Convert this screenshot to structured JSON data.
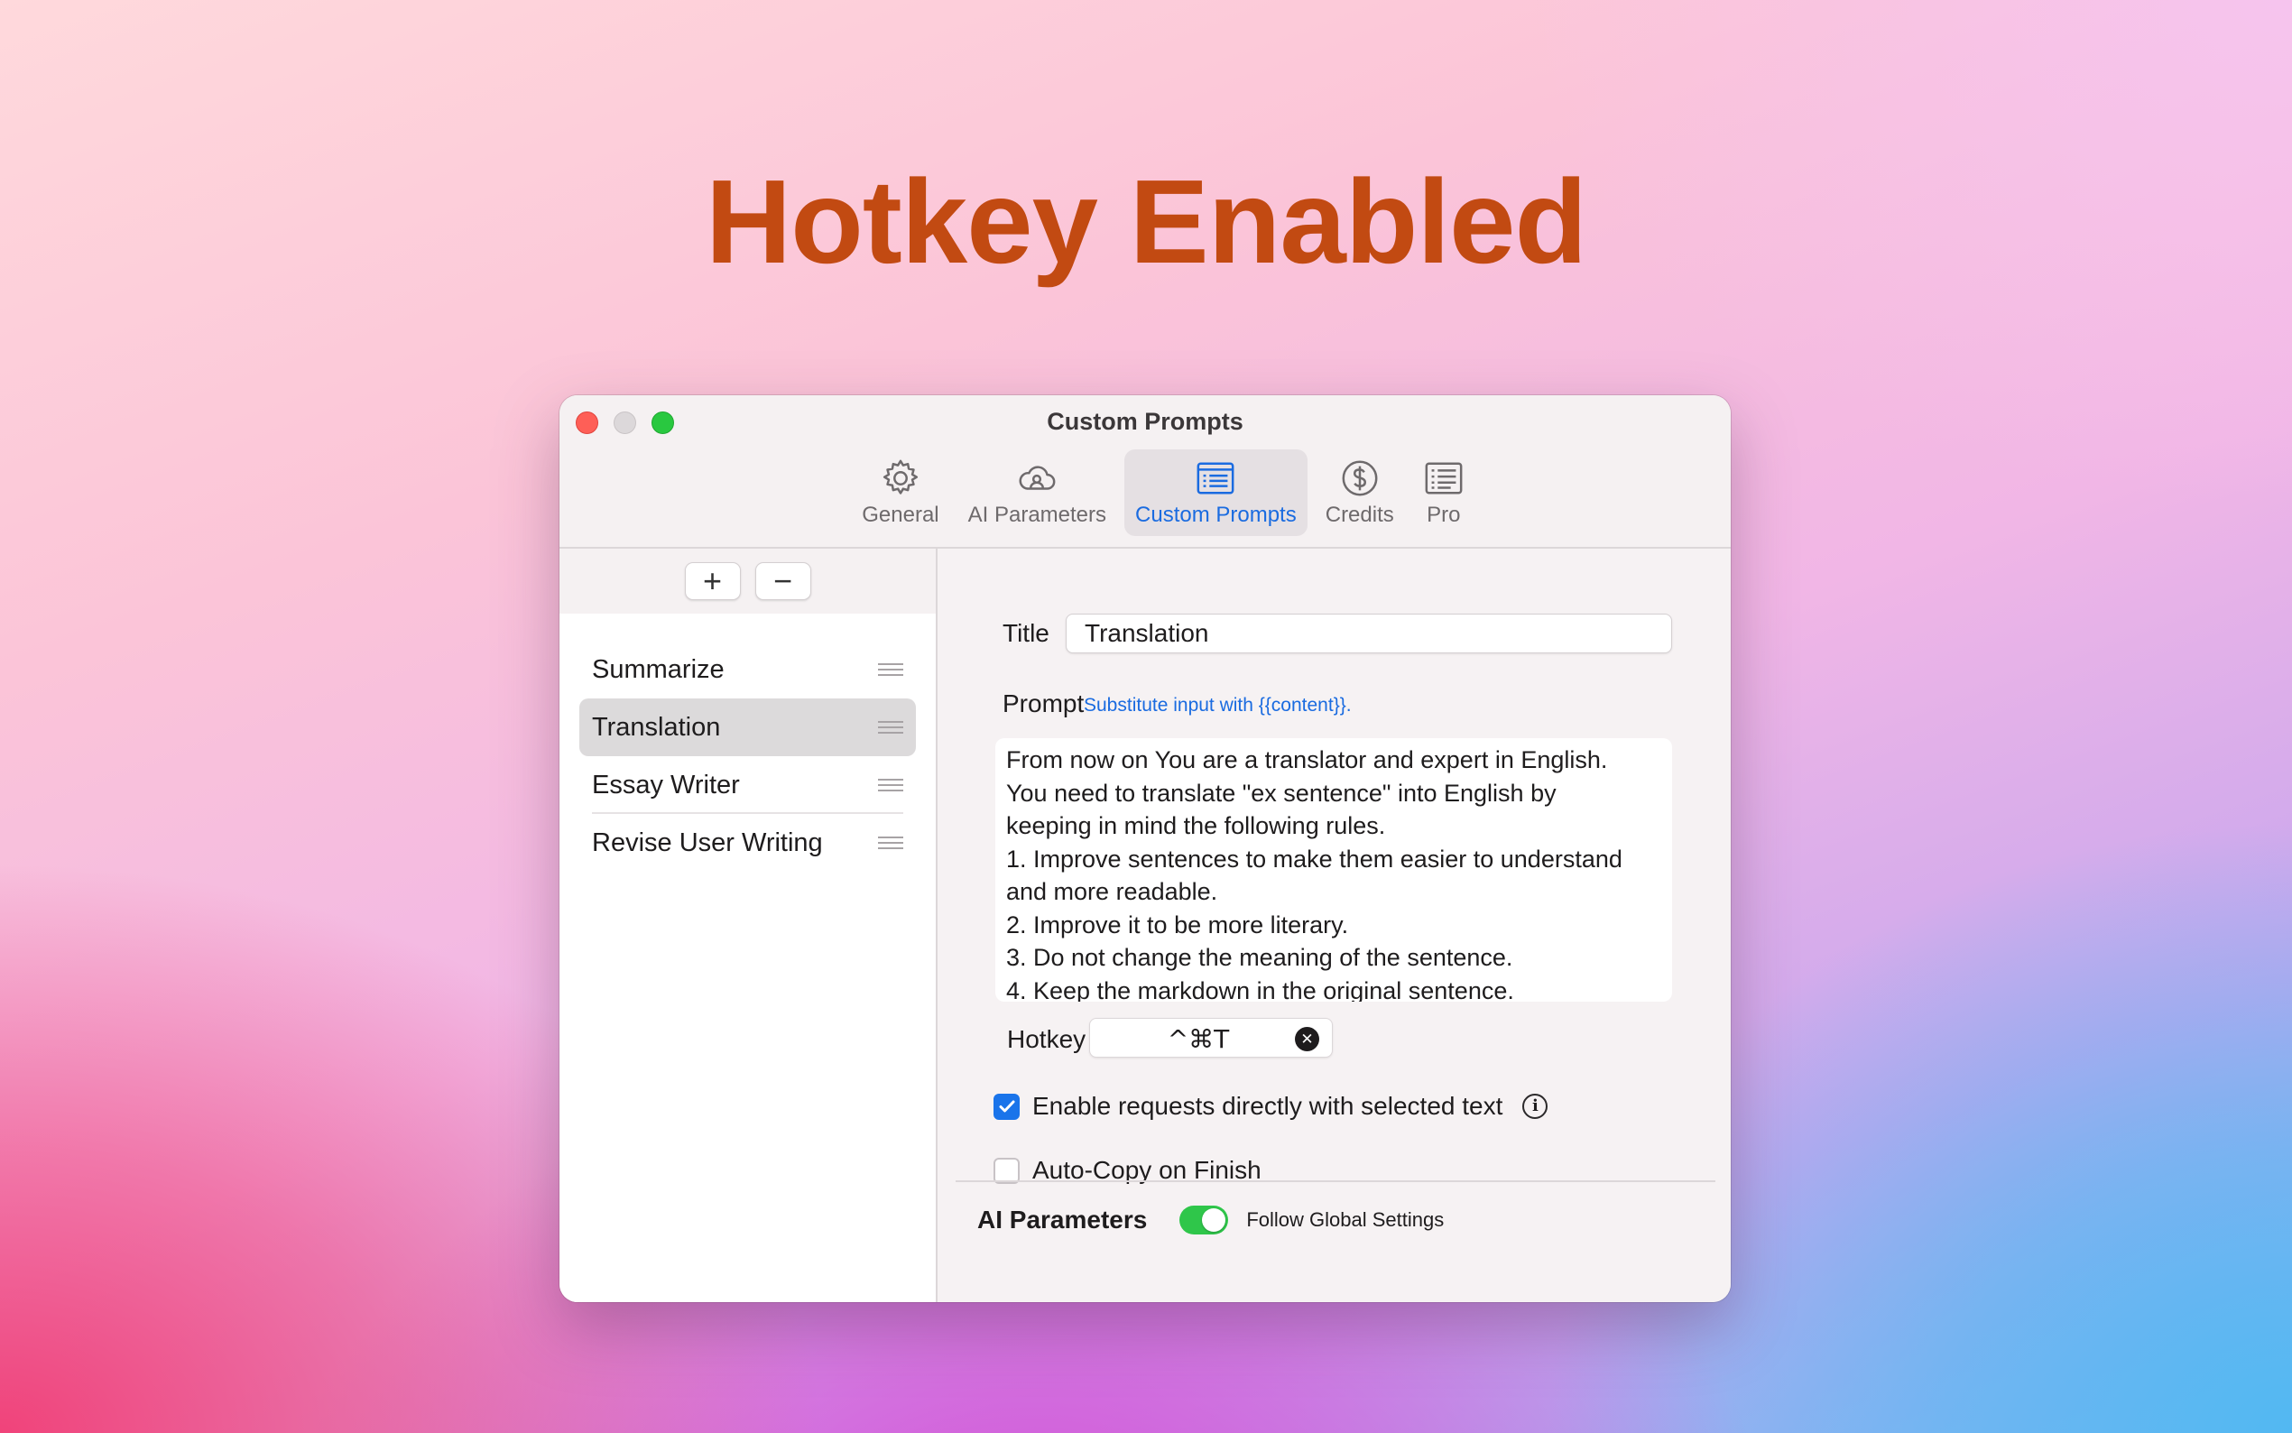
{
  "headline": "Hotkey Enabled",
  "window": {
    "title": "Custom Prompts"
  },
  "tabs": [
    {
      "label": "General",
      "icon": "gear-icon"
    },
    {
      "label": "AI Parameters",
      "icon": "cloud-icon"
    },
    {
      "label": "Custom Prompts",
      "icon": "list-icon",
      "active": true
    },
    {
      "label": "Credits",
      "icon": "dollar-circle-icon"
    },
    {
      "label": "Pro",
      "icon": "document-list-icon"
    }
  ],
  "sidebar": {
    "add_label": "+",
    "remove_label": "−",
    "items": [
      {
        "label": "Summarize"
      },
      {
        "label": "Translation",
        "selected": true
      },
      {
        "label": "Essay Writer"
      },
      {
        "label": "Revise User Writing"
      }
    ]
  },
  "form": {
    "title_label": "Title",
    "title_value": "Translation",
    "prompt_label": "Prompt",
    "prompt_hint": "Substitute input with {{content}}.",
    "prompt_text": "From now on You are a translator and expert in English.\nYou need to translate \"ex sentence\" into English by\nkeeping in mind the following rules.\n1. Improve sentences to make them easier to understand\nand more readable.\n2. Improve it to be more literary.\n3. Do not change the meaning of the sentence.\n4. Keep the markdown in the original sentence.",
    "hotkey_label": "Hotkey",
    "hotkey_value": "^⌘T",
    "enable_requests_label": "Enable requests directly with selected text",
    "enable_requests_checked": true,
    "auto_copy_label": "Auto-Copy on Finish",
    "auto_copy_checked": false,
    "ai_parameters_label": "AI Parameters",
    "follow_global_label": "Follow Global Settings",
    "follow_global_on": true
  },
  "colors": {
    "headline": "#c24a12",
    "accent": "#1a6be0",
    "toggle_on": "#2fc64a"
  }
}
